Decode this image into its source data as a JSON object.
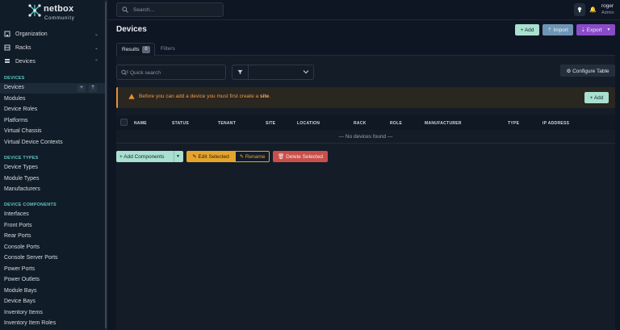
{
  "brand": {
    "name": "netbox",
    "edition": "Community"
  },
  "sidebar": {
    "top_items": [
      {
        "label": "Organization",
        "icon": "building-icon"
      },
      {
        "label": "Racks",
        "icon": "rack-icon"
      },
      {
        "label": "Devices",
        "icon": "server-icon"
      }
    ],
    "sections": [
      {
        "heading": "DEVICES",
        "items": [
          "Devices",
          "Modules",
          "Device Roles",
          "Platforms",
          "Virtual Chassis",
          "Virtual Device Contexts"
        ]
      },
      {
        "heading": "DEVICE TYPES",
        "items": [
          "Device Types",
          "Module Types",
          "Manufacturers"
        ]
      },
      {
        "heading": "DEVICE COMPONENTS",
        "items": [
          "Interfaces",
          "Front Ports",
          "Rear Ports",
          "Console Ports",
          "Console Server Ports",
          "Power Ports",
          "Power Outlets",
          "Module Bays",
          "Device Bays",
          "Inventory Items",
          "Inventory Item Roles"
        ]
      }
    ],
    "active_item": "Devices",
    "active_actions": [
      "+",
      "⇡"
    ]
  },
  "topbar": {
    "search_placeholder": "Search...",
    "user": "roger",
    "user_role": "Admin"
  },
  "page": {
    "title": "Devices",
    "actions": {
      "add": "+ Add",
      "import": "⇡ Import",
      "export": "⇣ Export"
    },
    "tabs": {
      "results": "Results",
      "results_count": "0",
      "filters": "Filters"
    },
    "quick_search_placeholder": "Quick search",
    "configure_table": "⚙ Configure Table",
    "alert": {
      "before": "Before you can add a device you must first create a ",
      "link": "site",
      "after": ".",
      "add": "+ Add"
    },
    "table": {
      "columns": [
        "NAME",
        "STATUS",
        "TENANT",
        "SITE",
        "LOCATION",
        "RACK",
        "ROLE",
        "MANUFACTURER",
        "TYPE",
        "IP ADDRESS"
      ],
      "empty_text": "— No devices found —"
    },
    "bulk_actions": {
      "add_components": "+ Add Components",
      "edit_selected": "✎ Edit Selected",
      "rename": "✎ Rename",
      "delete_selected": "🗑 Delete Selected"
    }
  },
  "colors": {
    "accent": "#a9e0d0",
    "section": "#5ec6c2",
    "export": "#8a4cc9",
    "warning": "#e6913b",
    "danger": "#c9504a"
  }
}
